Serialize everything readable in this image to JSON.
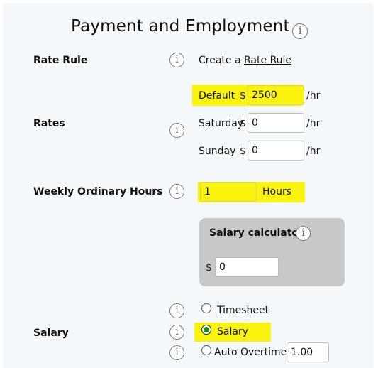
{
  "title": "Payment and Employment",
  "rate_rule": {
    "label": "Rate Rule",
    "create_prefix": "Create a",
    "create_link": "Rate Rule"
  },
  "rates": {
    "label": "Rates",
    "currency": "$",
    "unit": "/hr",
    "rows": [
      {
        "name": "Default",
        "value": "2500"
      },
      {
        "name": "Saturday",
        "value": "0"
      },
      {
        "name": "Sunday",
        "value": "0"
      }
    ]
  },
  "weekly_hours": {
    "label": "Weekly Ordinary Hours",
    "value": "1",
    "unit": "Hours"
  },
  "salary_calculator": {
    "title": "Salary calculator",
    "currency": "$",
    "value": "0"
  },
  "salary": {
    "label": "Salary",
    "options": [
      {
        "label": "Timesheet",
        "checked": false
      },
      {
        "label": "Salary",
        "checked": true
      },
      {
        "label": "Auto Overtime",
        "checked": false
      }
    ],
    "overtime_value": "1.00"
  },
  "colors": {
    "highlight": "#f9f30e",
    "panel": "#f4f8fb",
    "calculator_bg": "#c8c8c8",
    "radio_checked": "#1a8a1a"
  },
  "icons": {
    "info": "info-icon"
  }
}
